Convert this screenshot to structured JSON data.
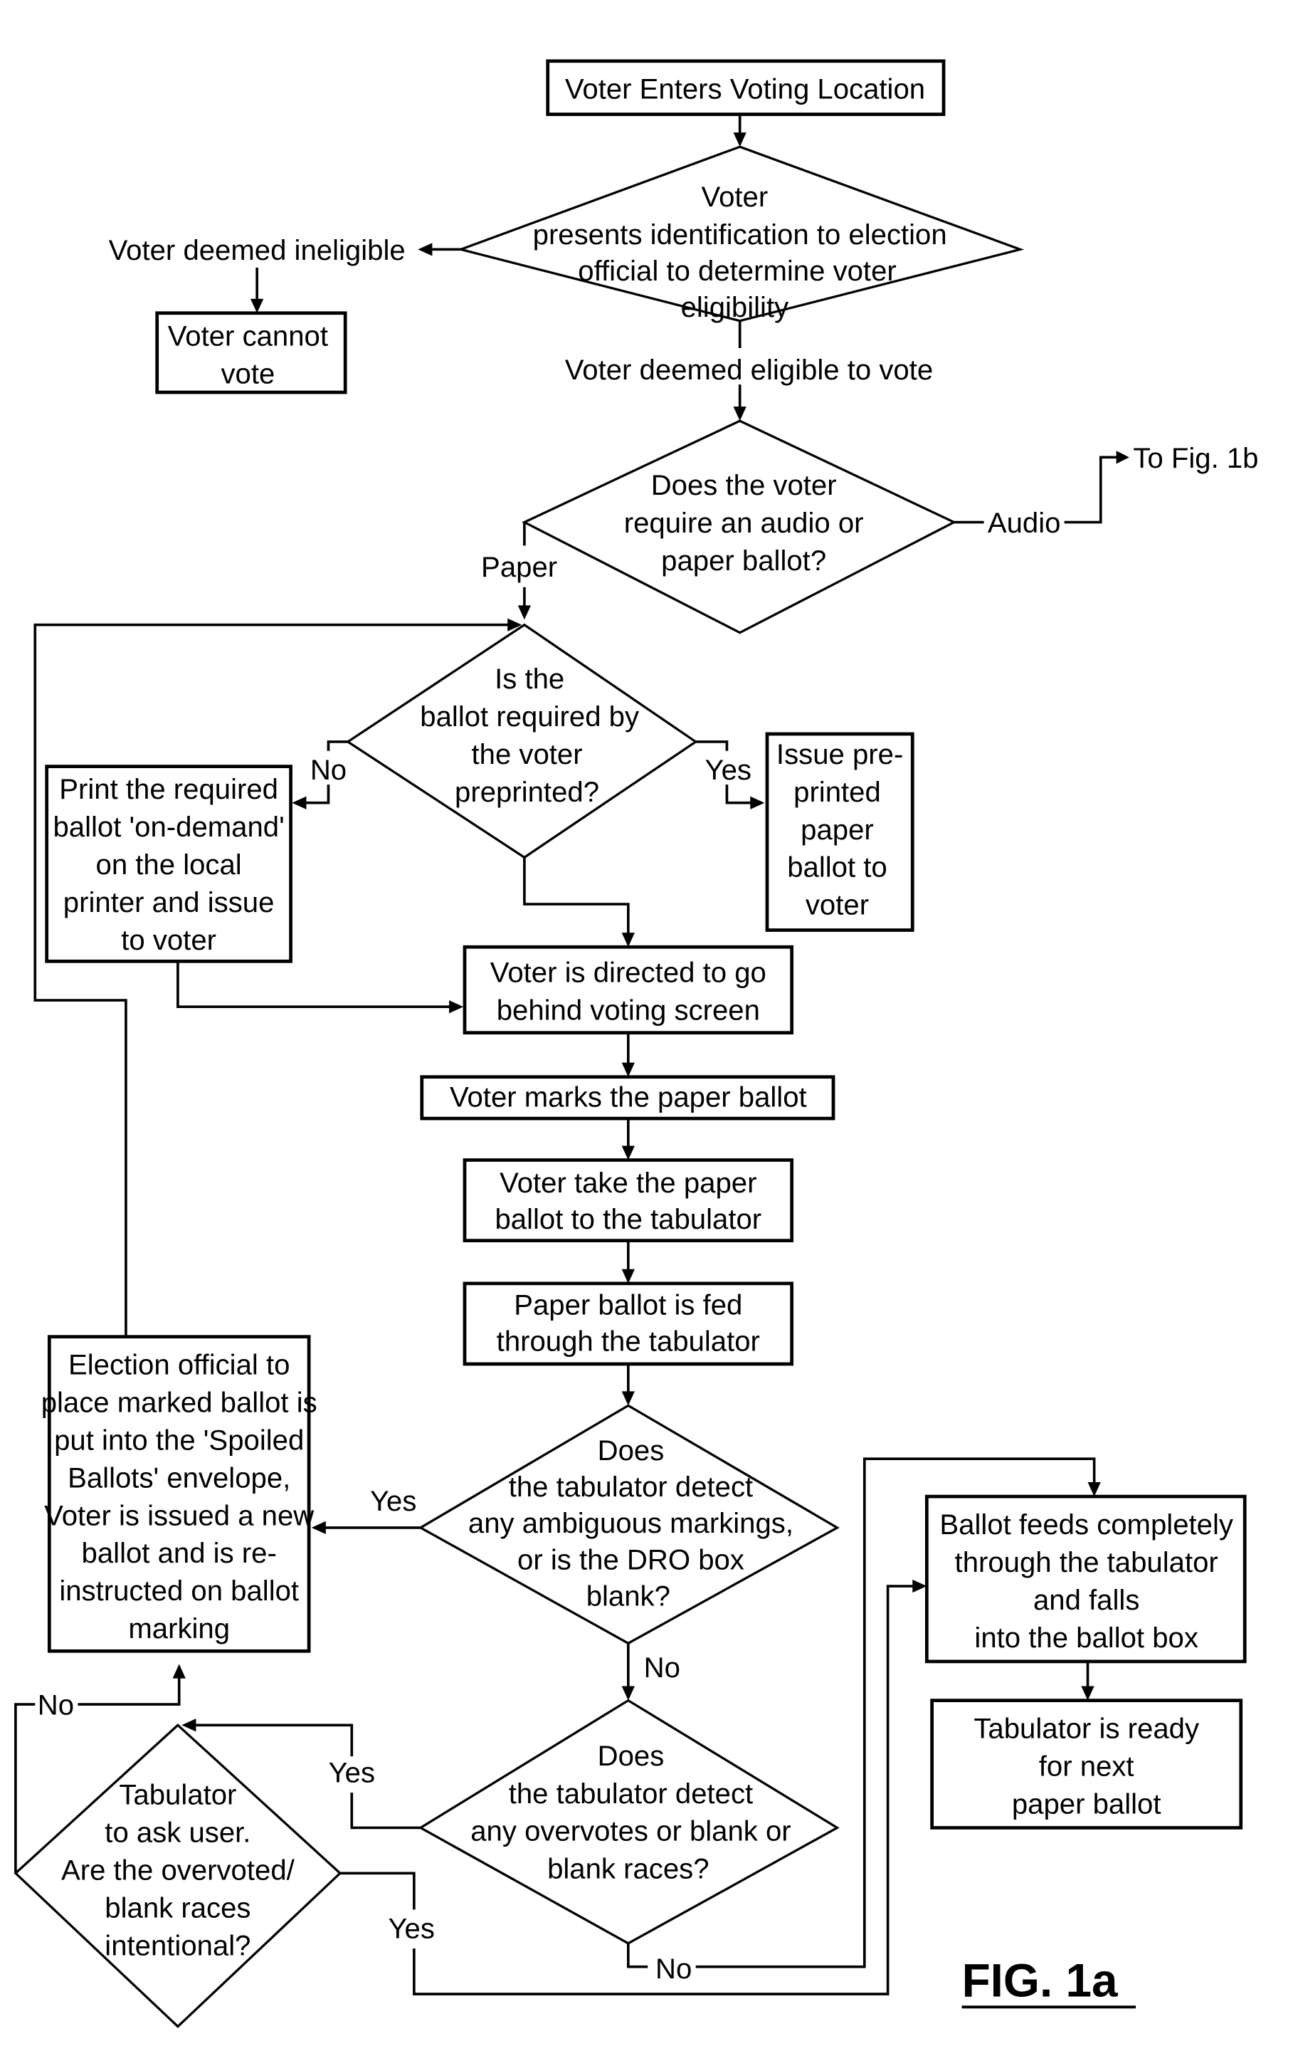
{
  "figure_label": "FIG. 1a",
  "nodes": {
    "start": "Voter Enters Voting Location",
    "id_check": [
      "Voter",
      "presents identification to election",
      "official to determine voter",
      "eligibility"
    ],
    "cannot_vote": [
      "Voter cannot",
      "vote"
    ],
    "ballot_type": [
      "Does the voter",
      "require an audio or",
      "paper ballot?"
    ],
    "preprinted_q": [
      "Is the",
      "ballot required by",
      "the voter",
      "preprinted?"
    ],
    "print_on_demand": [
      "Print the required",
      "ballot 'on-demand'",
      "on the local",
      "printer and issue",
      "to voter"
    ],
    "issue_preprinted": [
      "Issue pre-",
      "printed",
      "paper",
      "ballot to",
      "voter"
    ],
    "voting_screen": [
      "Voter is directed to go",
      "behind voting screen"
    ],
    "marks_ballot": "Voter marks the paper ballot",
    "take_to_tabulator": [
      "Voter take the paper",
      "ballot to the tabulator"
    ],
    "fed_through": [
      "Paper ballot is fed",
      "through the tabulator"
    ],
    "ambiguous_q": [
      "Does",
      "the tabulator detect",
      "any ambiguous markings,",
      "or is the DRO box",
      "blank?"
    ],
    "spoiled": [
      "Election official to",
      "place marked ballot is",
      "put into the 'Spoiled",
      "Ballots' envelope,",
      "Voter is issued a new",
      "ballot and is re-",
      "instructed on ballot",
      "marking"
    ],
    "overvotes_q": [
      "Does",
      "the tabulator detect",
      "any overvotes or blank or",
      "blank races?"
    ],
    "ask_user_q": [
      "Tabulator",
      "to ask user.",
      "Are the overvoted/",
      "blank races",
      "intentional?"
    ],
    "feeds_completely": [
      "Ballot feeds completely",
      "through the tabulator",
      "and falls",
      "into the ballot box"
    ],
    "ready_next": [
      "Tabulator is ready",
      "for next",
      "paper ballot"
    ]
  },
  "edge_labels": {
    "ineligible": "Voter deemed ineligible",
    "eligible": "Voter deemed eligible to vote",
    "audio": "Audio",
    "to_fig_1b": "To Fig. 1b",
    "paper": "Paper",
    "no_preprinted": "No",
    "yes_preprinted": "Yes",
    "yes_ambiguous": "Yes",
    "no_ambiguous": "No",
    "yes_overvotes": "Yes",
    "no_overvotes": "No",
    "no_intentional": "No",
    "yes_intentional": "Yes"
  }
}
